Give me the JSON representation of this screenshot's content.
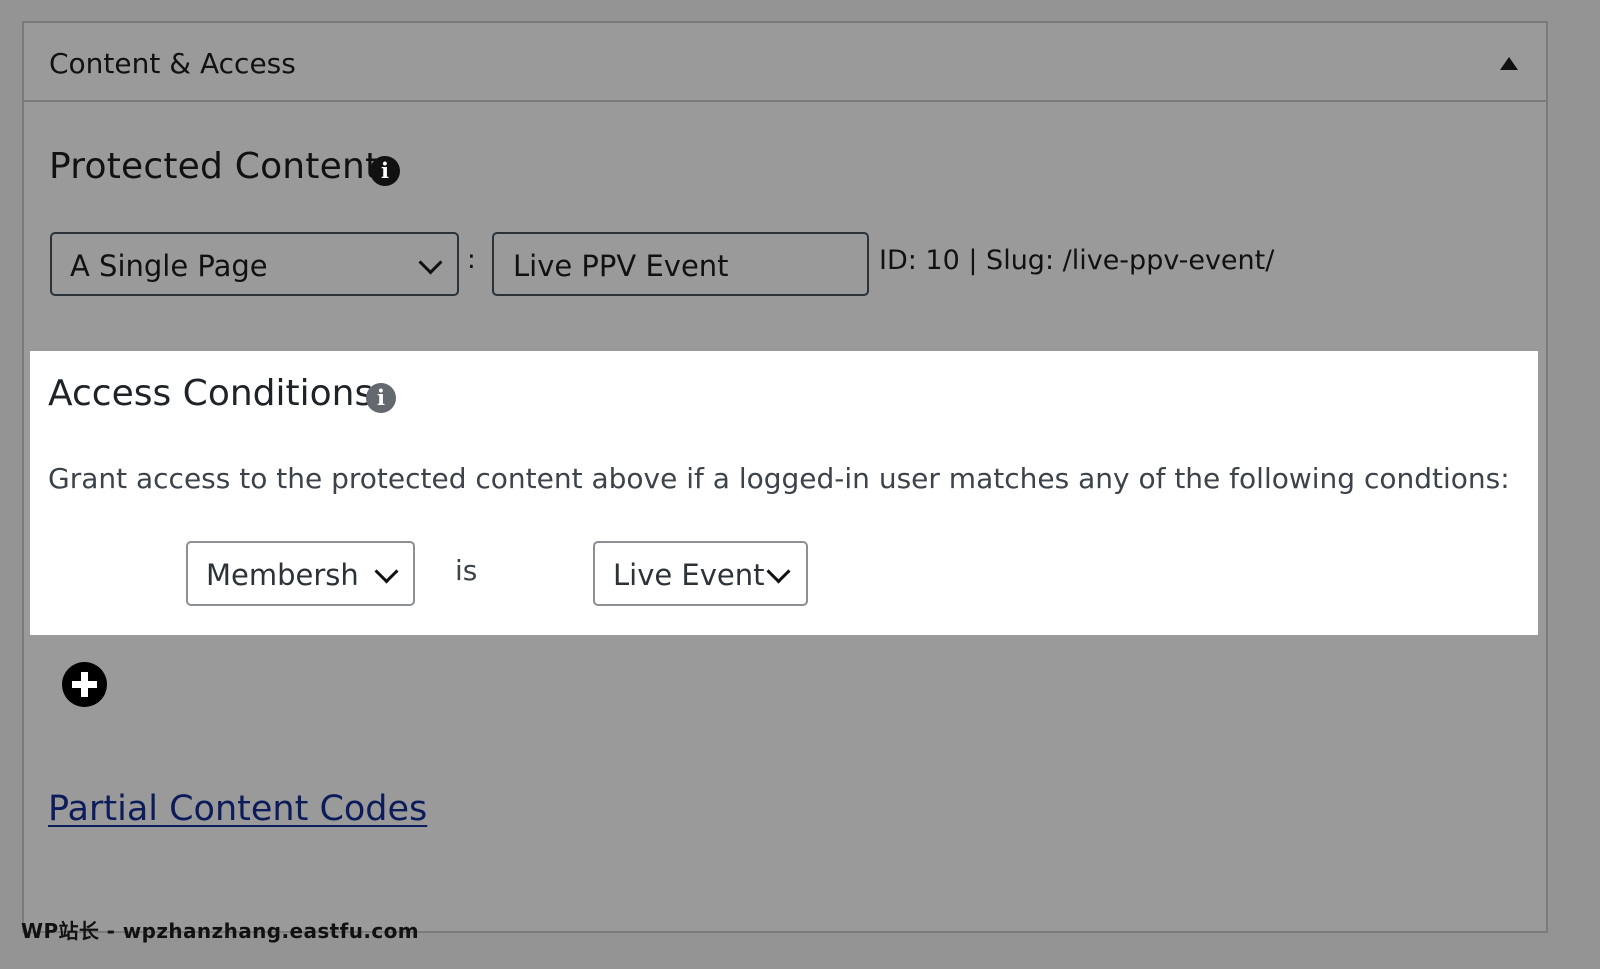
{
  "panel": {
    "title": "Content & Access",
    "collapse_icon": "triangle-up-icon"
  },
  "protected_content": {
    "title": "Protected Content",
    "info_icon": "info-icon",
    "type_select": {
      "value": "A Single Page"
    },
    "separator": ":",
    "page_input": {
      "value": "Live PPV Event"
    },
    "meta": "ID: 10 | Slug: /live-ppv-event/"
  },
  "access_conditions": {
    "title": "Access Conditions",
    "info_icon": "info-icon",
    "description": "Grant access to the protected content above if a logged-in user matches any of the following condtions:",
    "condition": {
      "field_select": "Membership",
      "operator": "is",
      "value_select": "Live Event"
    }
  },
  "add_condition_icon": "plus-circle-icon",
  "partial_content_link": "Partial Content Codes",
  "watermark": "WP站长 - wpzhanzhang.eastfu.com",
  "colors": {
    "page_background": "#949494",
    "panel_background": "#9a9a9a",
    "access_background": "#ffffff",
    "link_color": "#0c1b5a"
  }
}
